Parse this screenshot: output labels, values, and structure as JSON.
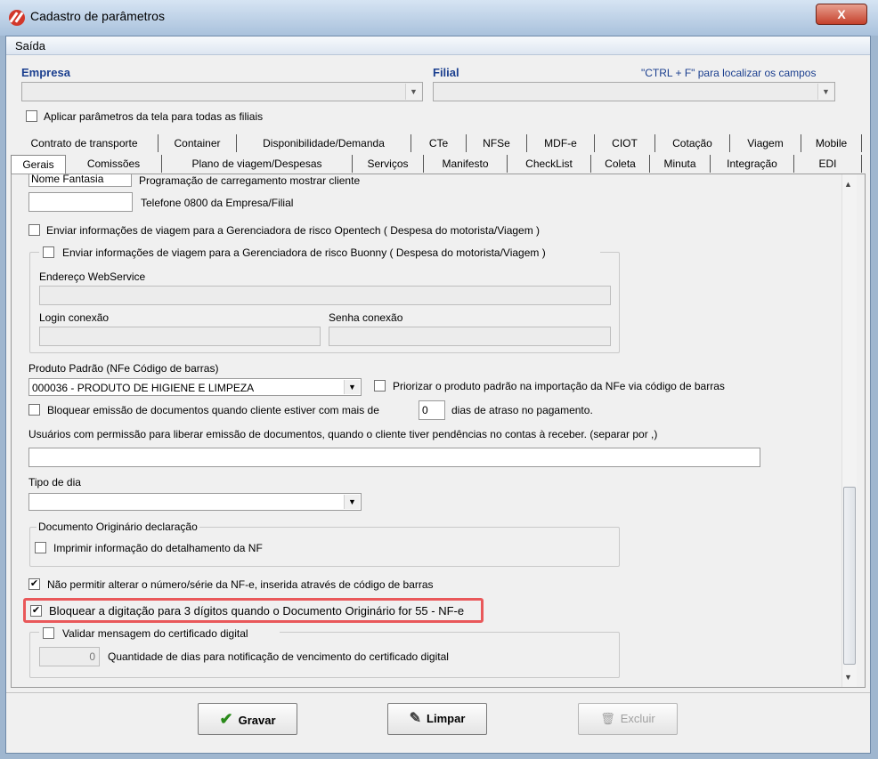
{
  "window": {
    "title": "Cadastro de parâmetros",
    "close_label": "X"
  },
  "menu": {
    "item": "Saída"
  },
  "header": {
    "empresa_label": "Empresa",
    "filial_label": "Filial",
    "hint": "\"CTRL + F\" para localizar os campos",
    "apply_all_label": "Aplicar parâmetros da tela para todas as filiais"
  },
  "tabs_row1": [
    "Contrato de transporte",
    "Container",
    "Disponibilidade/Demanda",
    "CTe",
    "NFSe",
    "MDF-e",
    "CIOT",
    "Cotação",
    "Viagem",
    "Mobile"
  ],
  "tabs_row2": [
    "Gerais",
    "Comissões",
    "Plano de viagem/Despesas",
    "Serviços",
    "Manifesto",
    "CheckList",
    "Coleta",
    "Minuta",
    "Integração",
    "EDI"
  ],
  "panel": {
    "nome_fantasia_value": "Nome Fantasia",
    "programacao_label": "Programação de carregamento mostrar cliente",
    "telefone_label": "Telefone 0800 da Empresa/Filial",
    "opentech_label": "Enviar informações de viagem para a Gerenciadora de risco Opentech ( Despesa do motorista/Viagem )",
    "buonny_label": "Enviar informações de viagem para a Gerenciadora de risco Buonny ( Despesa do motorista/Viagem )",
    "endereco_ws_label": "Endereço WebService",
    "login_label": "Login conexão",
    "senha_label": "Senha conexão",
    "produto_padrao_label": "Produto Padrão (NFe Código de barras)",
    "produto_padrao_value": "000036 - PRODUTO DE HIGIENE E LIMPEZA",
    "priorizar_label": "Priorizar o produto padrão na importação da NFe via código de barras",
    "bloquear_emissao_label": "Bloquear emissão de documentos quando cliente estiver com mais de",
    "dias_value": "0",
    "dias_atraso_label": "dias de atraso no pagamento.",
    "usuarios_label": "Usuários com permissão para liberar emissão de documentos, quando o cliente tiver pendências no contas à receber. (separar por ,)",
    "tipo_dia_label": "Tipo de dia",
    "doc_originario_group": "Documento Originário declaração",
    "imprimir_label": "Imprimir informação do detalhamento da NF",
    "nao_permitir_label": "Não permitir alterar o número/série da NF-e, inserida através de código de barras",
    "bloquear_digitacao_label": "Bloquear a digitação para 3 dígitos quando o Documento Originário for 55 - NF-e",
    "validar_label": "Validar mensagem do certificado digital",
    "qtd_dias_value": "0",
    "qtd_dias_label": "Quantidade de dias para notificação de vencimento do certificado digital"
  },
  "buttons": {
    "gravar": "Gravar",
    "limpar": "Limpar",
    "excluir": "Excluir"
  },
  "state": {
    "nao_permitir_checked": true,
    "bloquear_digitacao_checked": true
  },
  "colors": {
    "highlight": "#e9585a",
    "label_blue": "#1b3f8f"
  }
}
